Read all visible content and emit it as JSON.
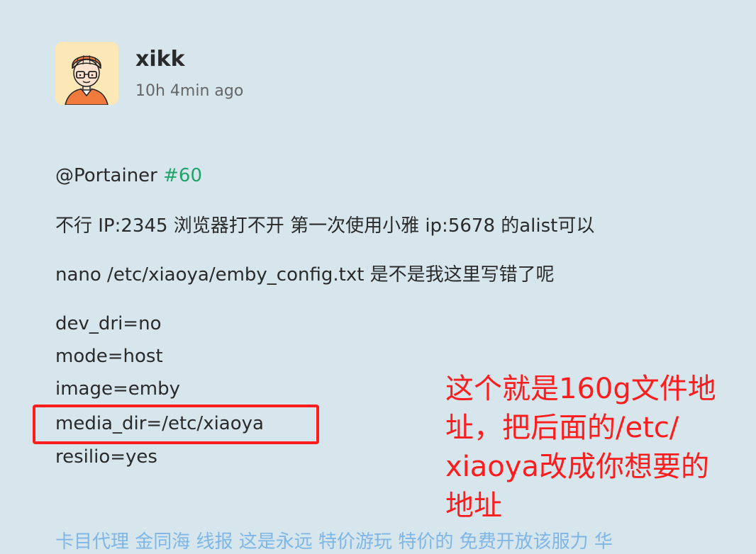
{
  "post": {
    "author": "xikk",
    "time": "10h 4min ago",
    "mention": "@Portainer",
    "issue": "#60",
    "paragraphs": [
      "不行 IP:2345 浏览器打不开 第一次使用小雅 ip:5678 的alist可以",
      "nano /etc/xiaoya/emby_config.txt 是不是我这里写错了呢"
    ],
    "config_lines": [
      "dev_dri=no",
      "mode=host",
      "image=emby",
      "media_dir=/etc/xiaoya",
      "resilio=yes"
    ],
    "next_line_partial": "卡目代理 金同海 线报 这是永远 特价游玩 特价的 免费开放该服力 华"
  },
  "annotation": {
    "lines": [
      "这个就是160g文件地",
      "址，把后面的/etc/",
      "xiaoya改成你想要的",
      "地址"
    ],
    "color": "#ff1c1c"
  },
  "colors": {
    "background": "#d6e6ec",
    "link": "#1fa36a",
    "annotation": "#ff1c1c"
  }
}
